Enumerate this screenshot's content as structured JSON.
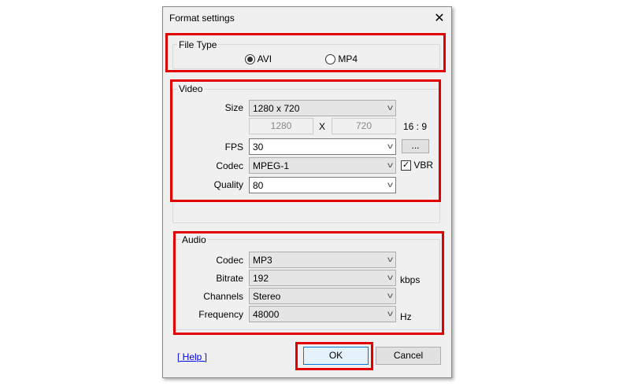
{
  "dialog": {
    "title": "Format settings",
    "close_icon": "close-icon"
  },
  "file_type": {
    "label": "File Type",
    "options": [
      "AVI",
      "MP4"
    ],
    "selected": "AVI"
  },
  "video": {
    "label": "Video",
    "size_label": "Size",
    "size_value": "1280 x 720",
    "width_value": "1280",
    "x_sep": "X",
    "height_value": "720",
    "aspect": "16 : 9",
    "fps_label": "FPS",
    "fps_value": "30",
    "more_button": "...",
    "codec_label": "Codec",
    "codec_value": "MPEG-1",
    "vbr_label": "VBR",
    "vbr_checked": true,
    "quality_label": "Quality",
    "quality_value": "80"
  },
  "audio": {
    "label": "Audio",
    "codec_label": "Codec",
    "codec_value": "MP3",
    "bitrate_label": "Bitrate",
    "bitrate_value": "192",
    "bitrate_unit": "kbps",
    "channels_label": "Channels",
    "channels_value": "Stereo",
    "frequency_label": "Frequency",
    "frequency_value": "48000",
    "frequency_unit": "Hz"
  },
  "footer": {
    "help": "[ Help ]",
    "ok": "OK",
    "cancel": "Cancel"
  },
  "colors": {
    "highlight": "#e00000",
    "link": "#0000ee",
    "ok_border": "#0078d7"
  }
}
